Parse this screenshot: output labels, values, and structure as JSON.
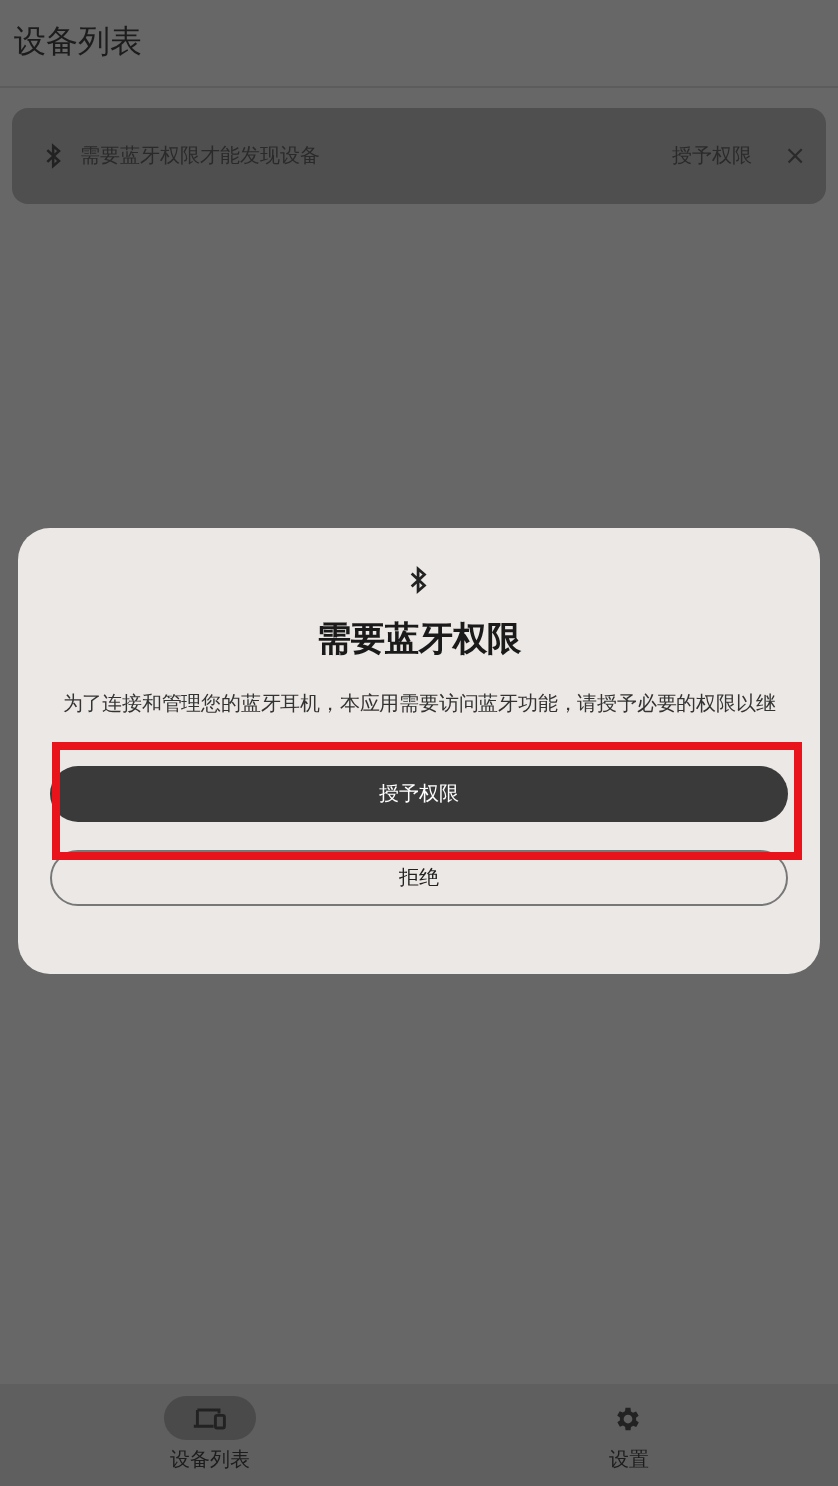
{
  "header": {
    "title": "设备列表"
  },
  "banner": {
    "message": "需要蓝牙权限才能发现设备",
    "action": "授予权限",
    "close": "×"
  },
  "dialog": {
    "title": "需要蓝牙权限",
    "message": "为了连接和管理您的蓝牙耳机，本应用需要访问蓝牙功能，请授予必要的权限以继",
    "buttons": [
      {
        "kind": "primary",
        "label": "授予权限"
      },
      {
        "kind": "outline",
        "label": "拒绝"
      }
    ]
  },
  "nav": [
    {
      "kind": "devices",
      "label": "设备列表",
      "selected": true
    },
    {
      "kind": "settings",
      "label": "设置",
      "selected": false
    }
  ]
}
